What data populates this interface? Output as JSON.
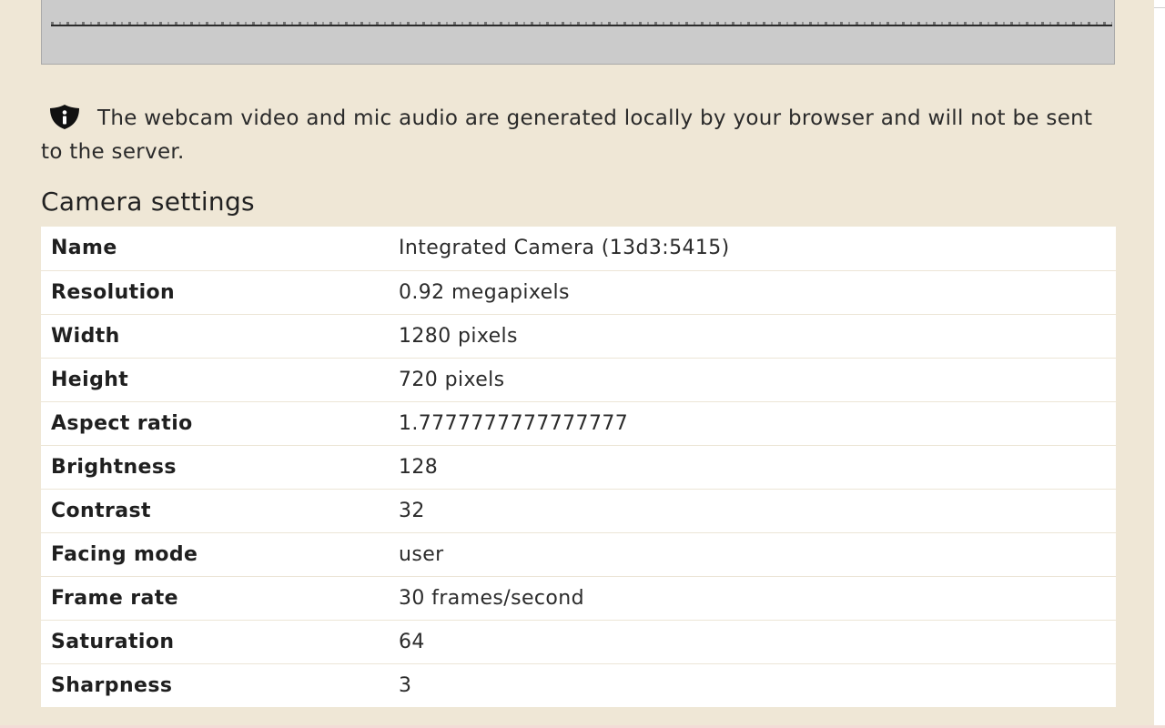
{
  "notice": {
    "text": "The webcam video and mic audio are generated locally by your browser and will not be sent to the server."
  },
  "camera_settings": {
    "title": "Camera settings",
    "rows": [
      {
        "key": "Name",
        "value": "Integrated Camera (13d3:5415)"
      },
      {
        "key": "Resolution",
        "value": "0.92 megapixels"
      },
      {
        "key": "Width",
        "value": "1280 pixels"
      },
      {
        "key": "Height",
        "value": "720 pixels"
      },
      {
        "key": "Aspect ratio",
        "value": "1.7777777777777777"
      },
      {
        "key": "Brightness",
        "value": "128"
      },
      {
        "key": "Contrast",
        "value": "32"
      },
      {
        "key": "Facing mode",
        "value": "user"
      },
      {
        "key": "Frame rate",
        "value": "30 frames/second"
      },
      {
        "key": "Saturation",
        "value": "64"
      },
      {
        "key": "Sharpness",
        "value": "3"
      }
    ]
  },
  "icons": {
    "notice_icon": "shield-info-icon"
  },
  "colors": {
    "panel_background": "#efe7d6",
    "table_background": "#ffffff",
    "preview_background": "#cbcbcb"
  }
}
